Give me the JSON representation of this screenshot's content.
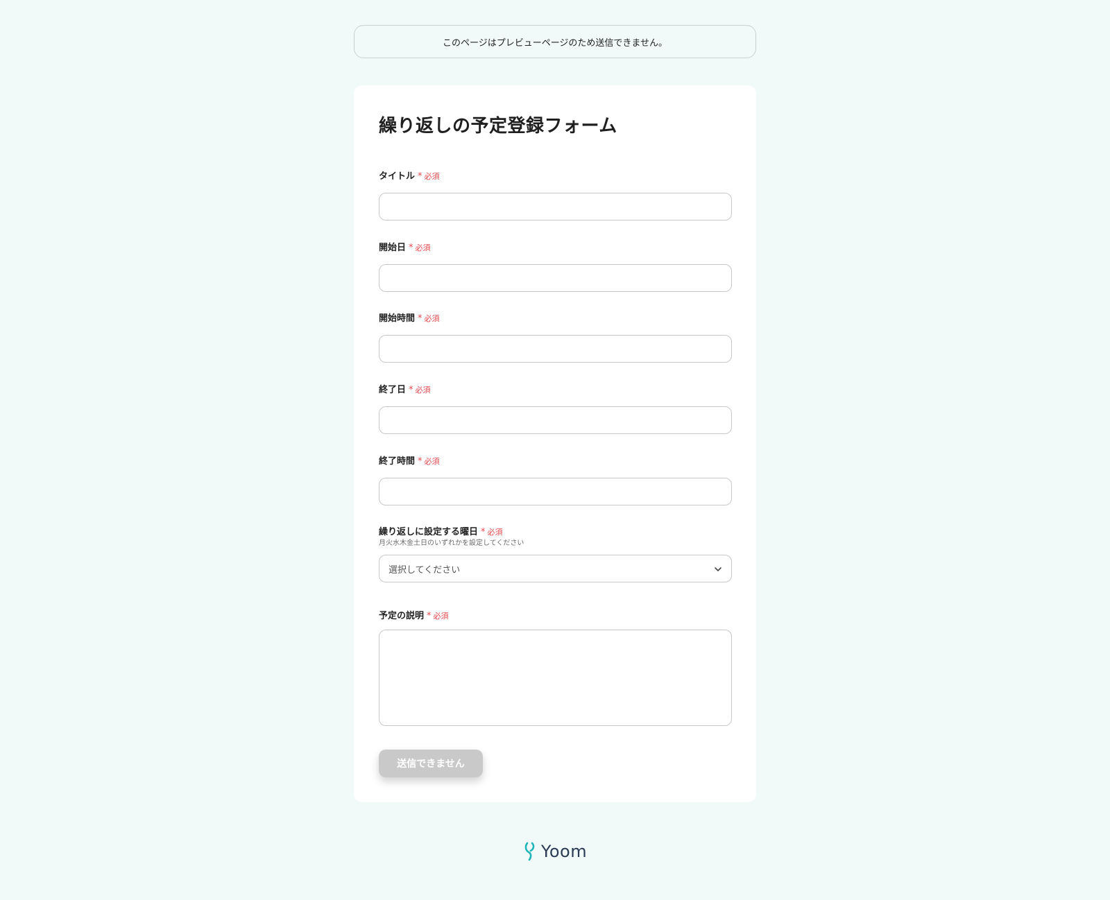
{
  "notice": {
    "text": "このページはプレビューページのため送信できません。"
  },
  "form": {
    "title": "繰り返しの予定登録フォーム",
    "required_mark": "*",
    "required_text": "必須",
    "fields": [
      {
        "label": "タイトル",
        "type": "text",
        "value": ""
      },
      {
        "label": "開始日",
        "type": "text",
        "value": ""
      },
      {
        "label": "開始時間",
        "type": "text",
        "value": ""
      },
      {
        "label": "終了日",
        "type": "text",
        "value": ""
      },
      {
        "label": "終了時間",
        "type": "text",
        "value": ""
      },
      {
        "label": "繰り返しに設定する曜日",
        "type": "select",
        "help": "月火水木金土日のいずれかを設定してください",
        "selected": "選択してください"
      },
      {
        "label": "予定の説明",
        "type": "textarea",
        "value": ""
      }
    ],
    "submit_label": "送信できません"
  },
  "footer": {
    "brand": "Yoom"
  },
  "colors": {
    "background": "#f1faf8",
    "required": "#e5484d",
    "button_disabled": "#c9c9c9",
    "brand_mark": "#1fb5b8",
    "brand_text": "#2b3a55"
  },
  "icons": {
    "select_chevron": "chevron-down-icon",
    "brand_logo": "yoom-logo-icon"
  }
}
